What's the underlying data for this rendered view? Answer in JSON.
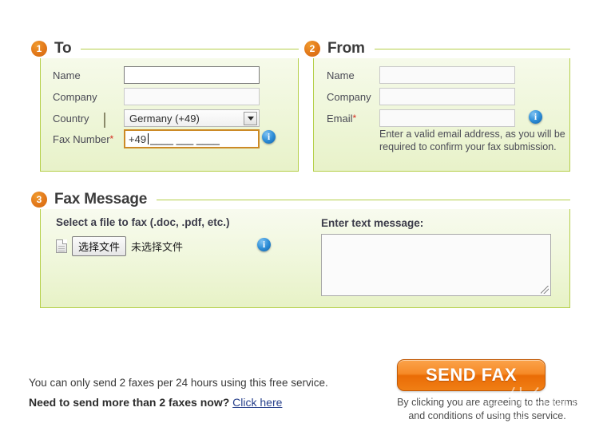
{
  "sections": [
    {
      "number": "1",
      "title": "To",
      "fields": [
        {
          "label": "Name",
          "required": false,
          "value": "",
          "state": "hover"
        },
        {
          "label": "Company",
          "required": false,
          "value": "",
          "state": "normal"
        },
        {
          "label": "Country",
          "required": false,
          "value": "Germany (+49)",
          "state": "select"
        },
        {
          "label": "Fax Number",
          "required": true,
          "value": "+49",
          "placeholder": "____ ___ ____",
          "state": "focus"
        }
      ],
      "country_flag": "germany-flag",
      "info_icon": "info-icon"
    },
    {
      "number": "2",
      "title": "From",
      "fields": [
        {
          "label": "Name",
          "required": false,
          "value": "",
          "state": "normal"
        },
        {
          "label": "Company",
          "required": false,
          "value": "",
          "state": "normal"
        },
        {
          "label": "Email",
          "required": true,
          "value": "",
          "state": "normal"
        }
      ],
      "note": "Enter a valid email address, as you will be required to confirm your fax submission.",
      "info_icon": "info-icon"
    },
    {
      "number": "3",
      "title": "Fax Message",
      "file_label": "Select a file to fax (.doc, .pdf, etc.)",
      "file_button": "选择文件",
      "file_status": "未选择文件",
      "file_icon": "document-icon",
      "info_icon": "info-icon",
      "message_label": "Enter text message:",
      "message_value": ""
    }
  ],
  "footer": {
    "limit_note": "You can only send 2 faxes per 24 hours using this free service.",
    "upsell_text": "Need to send more than 2 faxes now?",
    "upsell_link": "Click here",
    "send_button": "SEND FAX",
    "terms": "By clicking you are agreeing to the terms and conditions of using this service."
  },
  "watermark": {
    "mark": "值",
    "text": "什么值得买"
  },
  "colors": {
    "accent_orange": "#e2781a",
    "panel_border_green": "#b5cf49",
    "focus_border": "#cc8a26",
    "link_blue": "#28418c",
    "required_red": "#d52b1e",
    "send_button_orange": "#f68a28"
  }
}
